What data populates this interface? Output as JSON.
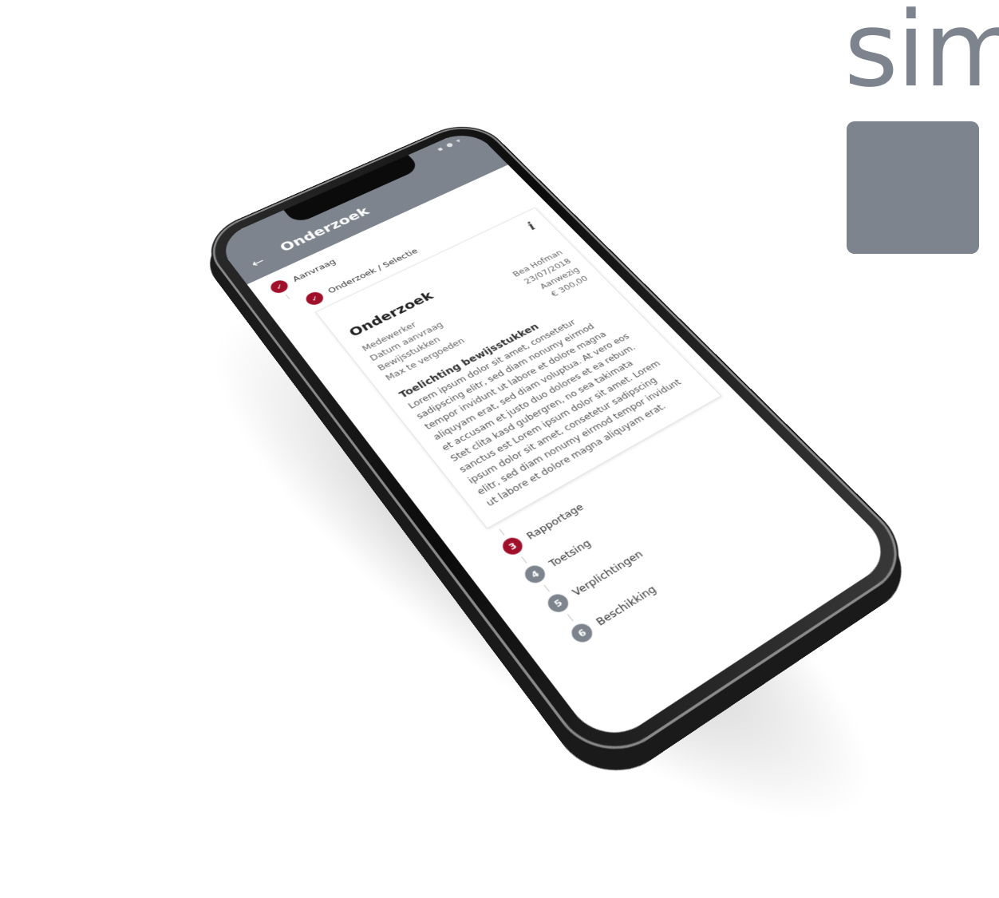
{
  "brand": {
    "text": "sim",
    "color": "#7d848d"
  },
  "status_bar": {
    "icons": "▪ ● ▾"
  },
  "app_bar": {
    "back_icon": "arrow-left-icon",
    "back_glyph": "←",
    "title": "Onderzoek"
  },
  "steps": [
    {
      "number": "✓",
      "label": "Aanvraag",
      "state": "done"
    },
    {
      "number": "✓",
      "label": "Onderzoek / Selectie",
      "state": "done"
    },
    {
      "number": "3",
      "label": "Rapportage",
      "state": "active"
    },
    {
      "number": "4",
      "label": "Toetsing",
      "state": "todo"
    },
    {
      "number": "5",
      "label": "Verplichtingen",
      "state": "todo"
    },
    {
      "number": "6",
      "label": "Beschikking",
      "state": "todo"
    }
  ],
  "card": {
    "info_glyph": "i",
    "title": "Onderzoek",
    "fields": [
      {
        "label": "Medewerker",
        "value": "Bea Hofman"
      },
      {
        "label": "Datum aanvraag",
        "value": "23/07/2018"
      },
      {
        "label": "Bewijsstukken",
        "value": "Aanwezig"
      },
      {
        "label": "Max te vergoeden",
        "value": "€ 300,00"
      }
    ],
    "section_title": "Toelichting bewijsstukken",
    "body": "Lorem ipsum dolor sit amet, consetetur sadipscing elitr, sed diam nonumy eirmod tempor invidunt ut labore et dolore magna aliquyam erat, sed diam voluptua. At vero eos et accusam et justo duo dolores et ea rebum. Stet clita kasd gubergren, no sea takimata sanctus est Lorem ipsum dolor sit amet. Lorem ipsum dolor sit amet, consetetur sadipscing elitr, sed diam nonumy eirmod tempor invidunt ut labore et dolore magna aliquyam erat."
  },
  "colors": {
    "primary": "#7d848d",
    "accent": "#a0102a"
  }
}
